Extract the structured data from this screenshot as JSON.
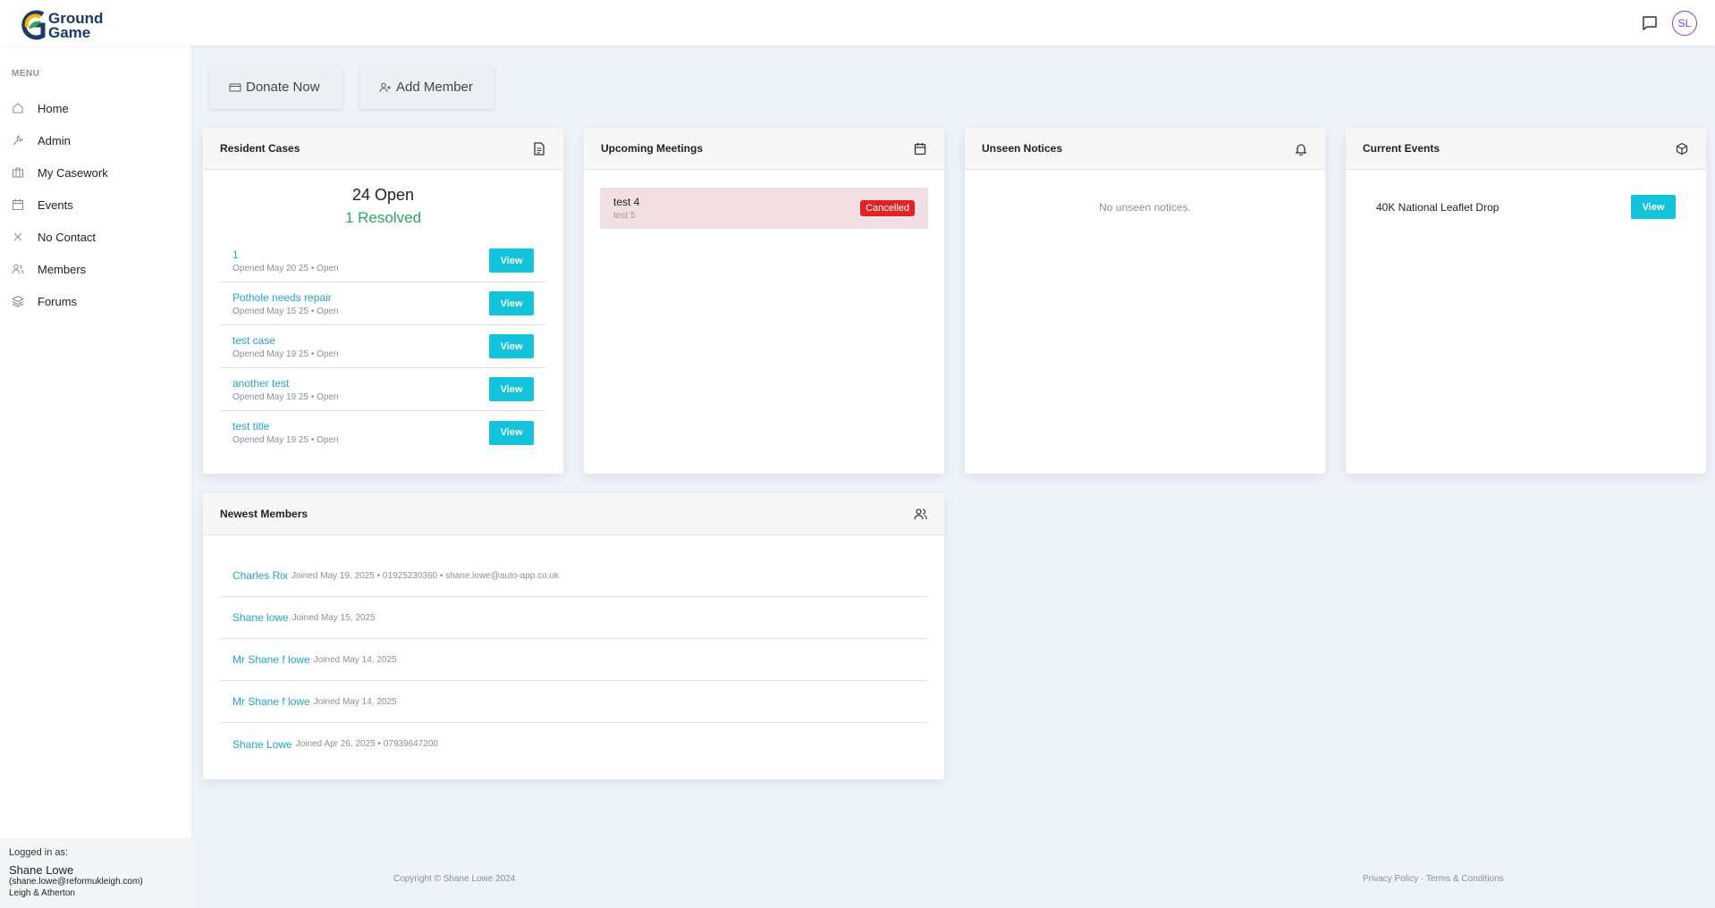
{
  "app": {
    "logo_line1": "Ground",
    "logo_line2": "Game",
    "avatar_initials": "SL"
  },
  "colors": {
    "accent": "#12c3db",
    "link": "#22a7c4",
    "resolved": "#2ea95b",
    "cancelled": "#e02424",
    "avatar": "#8b3fd1"
  },
  "sidebar": {
    "menu_title": "MENU",
    "items": [
      {
        "label": "Home",
        "icon": "home-icon"
      },
      {
        "label": "Admin",
        "icon": "wrench-icon"
      },
      {
        "label": "My Casework",
        "icon": "briefcase-icon"
      },
      {
        "label": "Events",
        "icon": "calendar-icon"
      },
      {
        "label": "No Contact",
        "icon": "x-icon"
      },
      {
        "label": "Members",
        "icon": "users-icon"
      },
      {
        "label": "Forums",
        "icon": "layers-icon"
      }
    ],
    "footer": {
      "logged_in_label": "Logged in as:",
      "user_name": "Shane Lowe",
      "user_email": "(shane.lowe@reformukleigh.com)",
      "constituency": "Leigh & Atherton"
    }
  },
  "actions": {
    "donate_label": "Donate Now",
    "add_member_label": "Add Member"
  },
  "resident_cases": {
    "title": "Resident Cases",
    "open_summary": "24 Open",
    "resolved_summary": "1 Resolved",
    "view_label": "View",
    "cases": [
      {
        "name": "1",
        "meta": "Opened May 20 25 • Open"
      },
      {
        "name": "Pothole needs repair",
        "meta": "Opened May 15 25 • Open"
      },
      {
        "name": "test case",
        "meta": "Opened May 19 25 • Open"
      },
      {
        "name": "another test",
        "meta": "Opened May 19 25 • Open"
      },
      {
        "name": "test title",
        "meta": "Opened May 19 25 • Open"
      }
    ]
  },
  "upcoming_meetings": {
    "title": "Upcoming Meetings",
    "meetings": [
      {
        "title": "test 4",
        "subtitle": "test 5",
        "status": "Cancelled"
      }
    ]
  },
  "unseen_notices": {
    "title": "Unseen Notices",
    "empty_message": "No unseen notices."
  },
  "current_events": {
    "title": "Current Events",
    "view_label": "View",
    "events": [
      {
        "name": "40K National Leaflet Drop"
      }
    ]
  },
  "newest_members": {
    "title": "Newest Members",
    "members": [
      {
        "name": "Charles Rix",
        "details": "Joined May 19, 2025 • 01925230360 • shane.lowe@auto-app.co.uk"
      },
      {
        "name": "Shane lowe",
        "details": "Joined May 15, 2025"
      },
      {
        "name": "Mr Shane f lowe",
        "details": "Joined May 14, 2025"
      },
      {
        "name": "Mr Shane f lowe",
        "details": "Joined May 14, 2025"
      },
      {
        "name": "Shane Lowe",
        "details": "Joined Apr 26, 2025 • 07939647200"
      }
    ]
  },
  "footer": {
    "copyright": "Copyright © Shane Lowe 2024",
    "privacy_label": "Privacy Policy",
    "separator": "·",
    "terms_label": "Terms & Conditions"
  }
}
